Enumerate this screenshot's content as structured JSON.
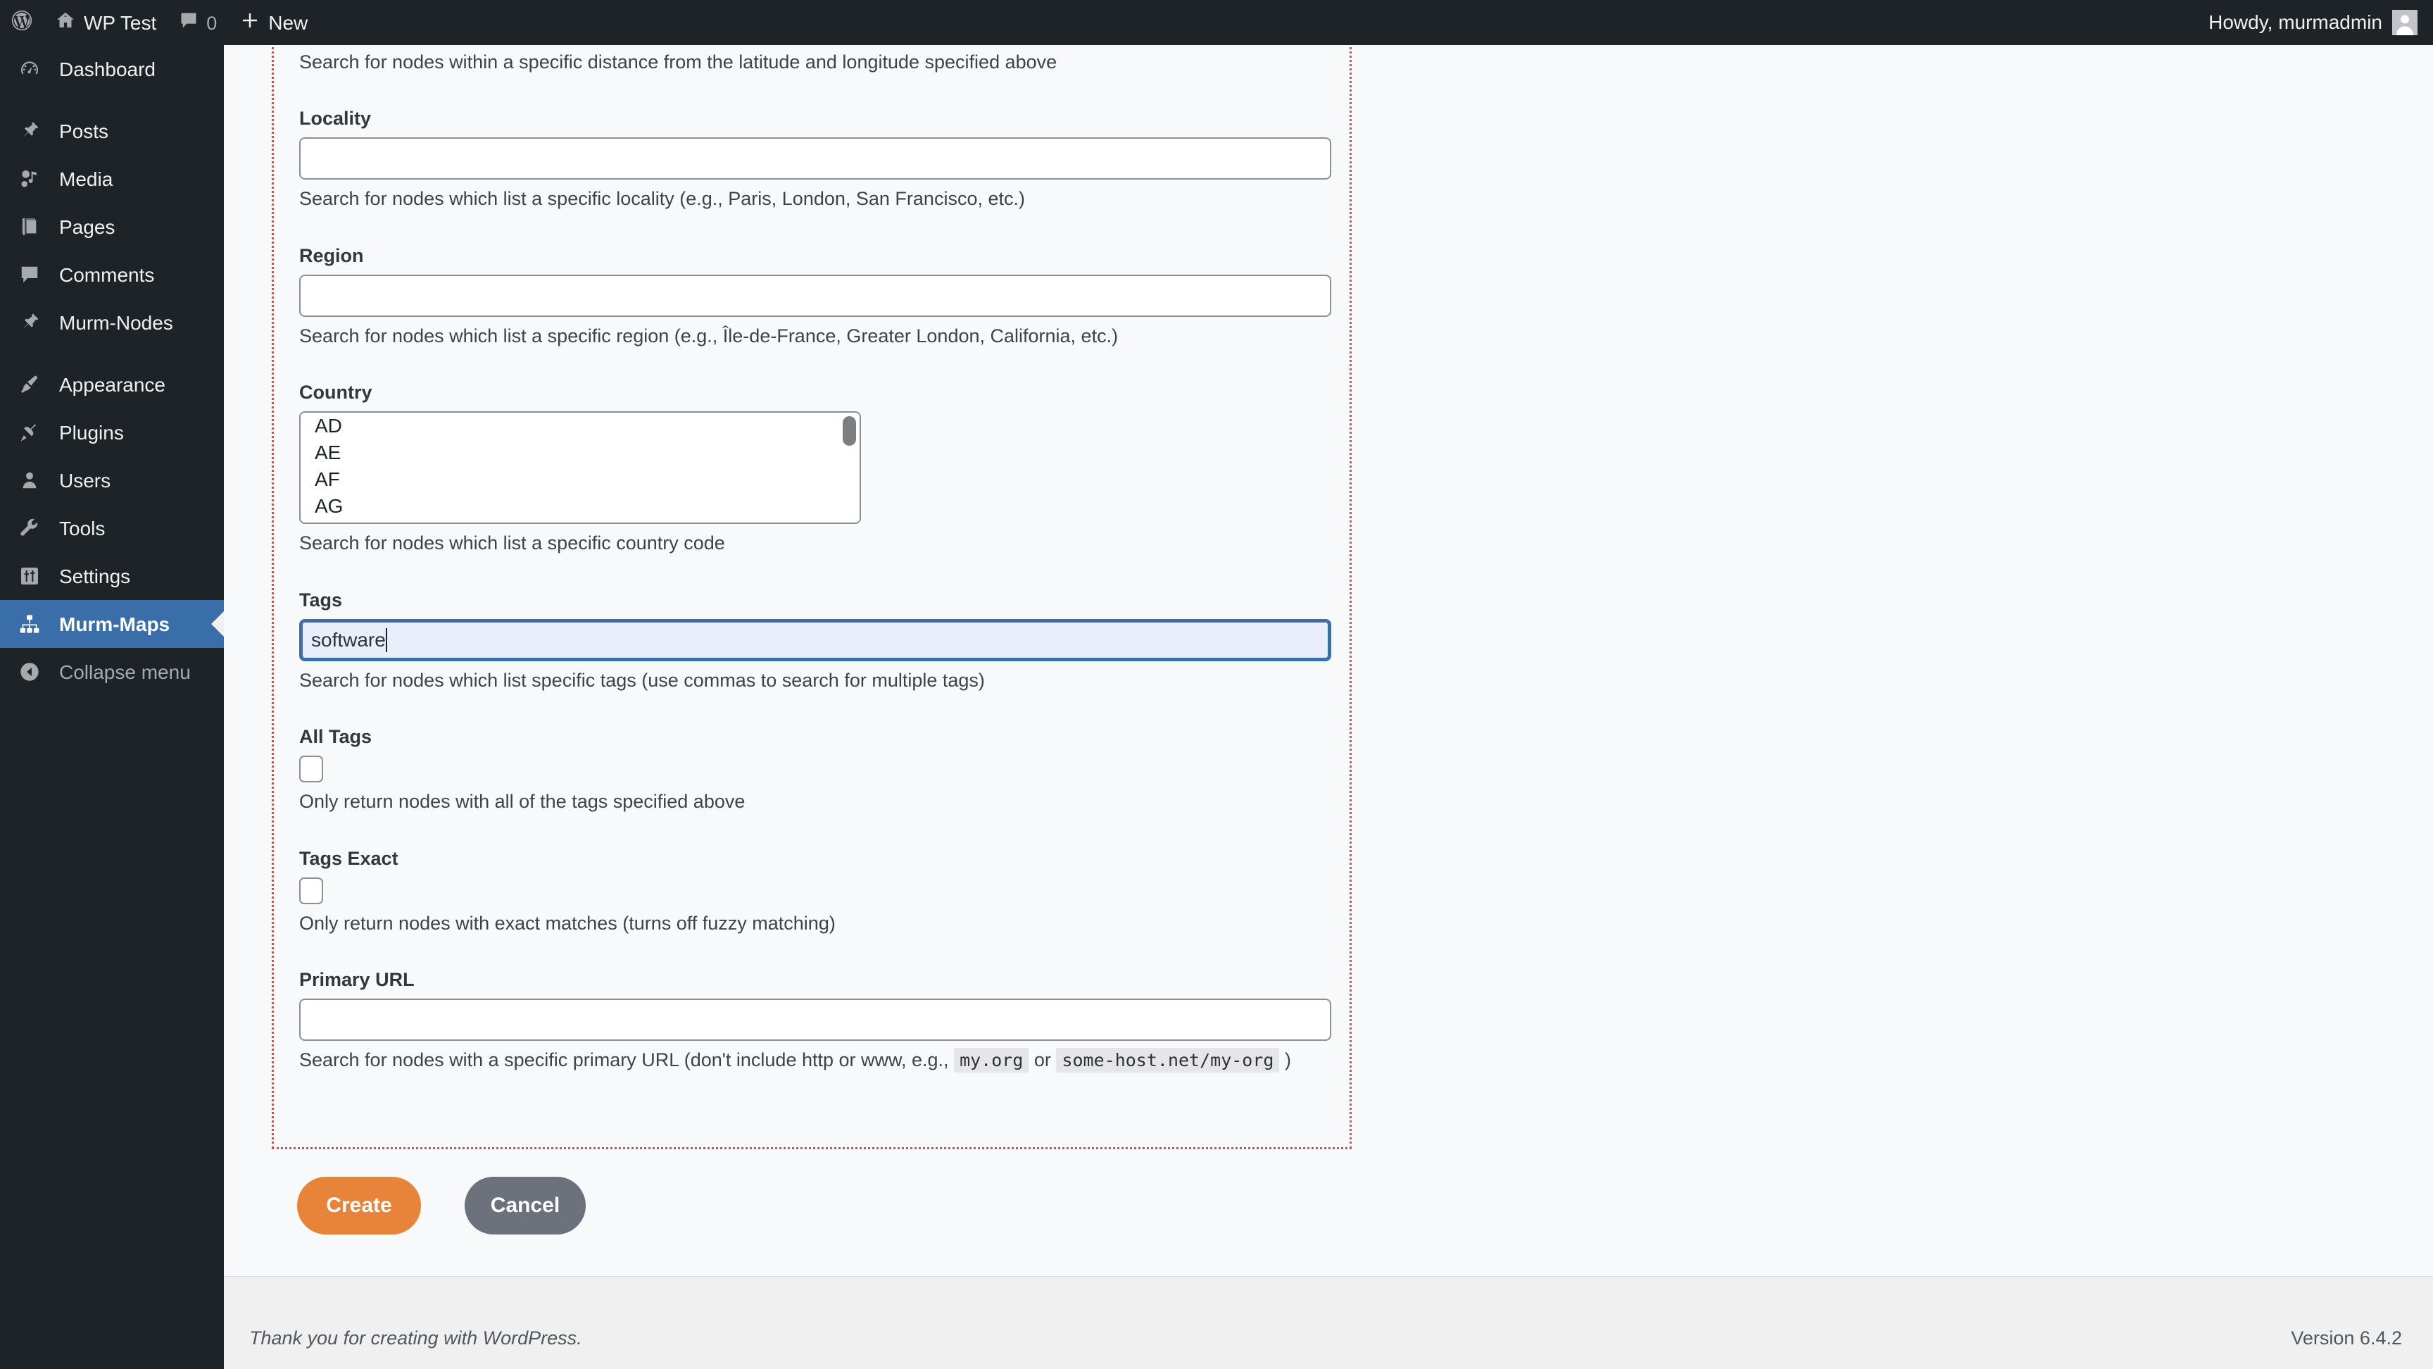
{
  "adminbar": {
    "logo_icon": "wordpress-logo-icon",
    "site_name": "WP Test",
    "site_icon": "home-icon",
    "comments_icon": "comment-bubble-icon",
    "comments_count": "0",
    "new_icon": "plus-icon",
    "new_label": "New",
    "howdy": "Howdy, murmadmin",
    "avatar_icon": "user-avatar-icon"
  },
  "sidebar": {
    "items": [
      {
        "label": "Dashboard",
        "icon": "dashboard-icon",
        "current": false
      },
      {
        "label": "Posts",
        "icon": "pin-icon",
        "current": false
      },
      {
        "label": "Media",
        "icon": "media-icon",
        "current": false
      },
      {
        "label": "Pages",
        "icon": "pages-icon",
        "current": false
      },
      {
        "label": "Comments",
        "icon": "comment-bubble-icon",
        "current": false
      },
      {
        "label": "Murm-Nodes",
        "icon": "pin-icon",
        "current": false
      },
      {
        "label": "Appearance",
        "icon": "paintbrush-icon",
        "current": false
      },
      {
        "label": "Plugins",
        "icon": "plug-icon",
        "current": false
      },
      {
        "label": "Users",
        "icon": "user-icon",
        "current": false
      },
      {
        "label": "Tools",
        "icon": "wrench-icon",
        "current": false
      },
      {
        "label": "Settings",
        "icon": "sliders-icon",
        "current": false
      },
      {
        "label": "Murm-Maps",
        "icon": "network-icon",
        "current": true
      }
    ],
    "collapse": {
      "label": "Collapse menu",
      "icon": "collapse-arrow-icon"
    }
  },
  "form": {
    "distance_description": "Search for nodes within a specific distance from the latitude and longitude specified above",
    "locality": {
      "label": "Locality",
      "value": "",
      "description": "Search for nodes which list a specific locality (e.g., Paris, London, San Francisco, etc.)"
    },
    "region": {
      "label": "Region",
      "value": "",
      "description": "Search for nodes which list a specific region (e.g., Île-de-France, Greater London, California, etc.)"
    },
    "country": {
      "label": "Country",
      "options": [
        "AD",
        "AE",
        "AF",
        "AG"
      ],
      "description": "Search for nodes which list a specific country code"
    },
    "tags": {
      "label": "Tags",
      "value": "software",
      "description": "Search for nodes which list specific tags (use commas to search for multiple tags)"
    },
    "all_tags": {
      "label": "All Tags",
      "checked": false,
      "description": "Only return nodes with all of the tags specified above"
    },
    "tags_exact": {
      "label": "Tags Exact",
      "checked": false,
      "description": "Only return nodes with exact matches (turns off fuzzy matching)"
    },
    "primary_url": {
      "label": "Primary URL",
      "value": "",
      "desc_before": "Search for nodes with a specific primary URL (don't include http or www, e.g.,",
      "code1": "my.org",
      "desc_mid": "or",
      "code2": "some-host.net/my-org",
      "desc_after": ")"
    }
  },
  "actions": {
    "create_label": "Create",
    "cancel_label": "Cancel"
  },
  "footer": {
    "thanks": "Thank you for creating with WordPress.",
    "version": "Version 6.4.2"
  },
  "colors": {
    "admin_dark": "#1d2327",
    "accent_blue": "#3a6ea8",
    "create_orange": "#e8833a",
    "cancel_grey": "#6c717c",
    "debug_border_red": "#e04a43"
  }
}
